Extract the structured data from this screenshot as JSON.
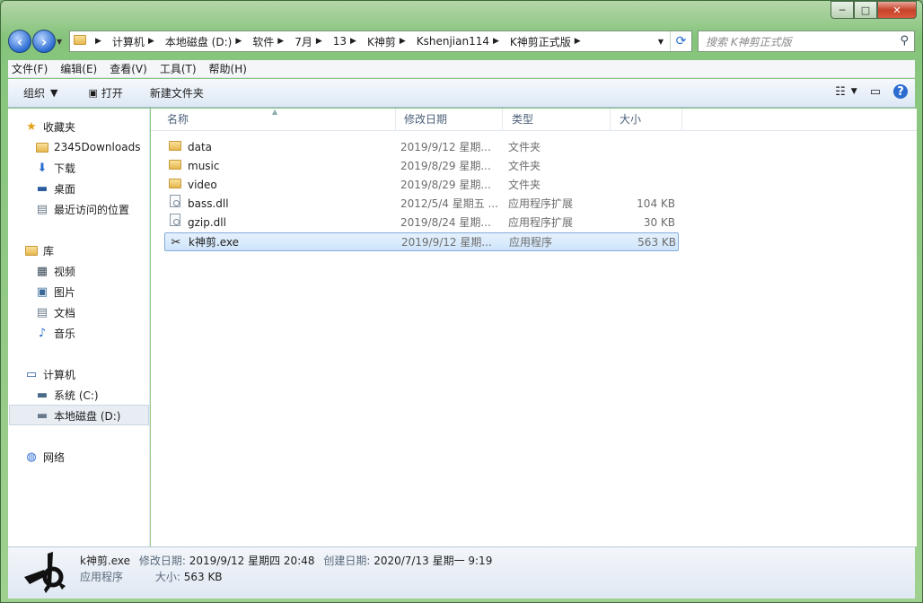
{
  "window": {
    "caption": {
      "minimize": "─",
      "maximize": "□",
      "close": "✕"
    }
  },
  "address": {
    "crumbs": [
      "计算机",
      "本地磁盘 (D:)",
      "软件",
      "7月",
      "13",
      "K神剪",
      "Kshenjian114",
      "K神剪正式版"
    ],
    "search_placeholder": "搜索 K神剪正式版"
  },
  "menu": [
    "文件(F)",
    "编辑(E)",
    "查看(V)",
    "工具(T)",
    "帮助(H)"
  ],
  "toolbar": {
    "organize": "组织",
    "open": "打开",
    "new_folder": "新建文件夹"
  },
  "nav": {
    "favorites": "收藏夹",
    "fav_items": [
      "2345Downloads",
      "下载",
      "桌面",
      "最近访问的位置"
    ],
    "library": "库",
    "lib_items": [
      "视频",
      "图片",
      "文档",
      "音乐"
    ],
    "computer": "计算机",
    "drives": [
      "系统 (C:)",
      "本地磁盘 (D:)"
    ],
    "network": "网络"
  },
  "columns": {
    "name": "名称",
    "date": "修改日期",
    "type": "类型",
    "size": "大小"
  },
  "files": [
    {
      "name": "data",
      "date": "2019/9/12 星期...",
      "type": "文件夹",
      "size": "",
      "icon": "folder"
    },
    {
      "name": "music",
      "date": "2019/8/29 星期...",
      "type": "文件夹",
      "size": "",
      "icon": "folder"
    },
    {
      "name": "video",
      "date": "2019/8/29 星期...",
      "type": "文件夹",
      "size": "",
      "icon": "folder"
    },
    {
      "name": "bass.dll",
      "date": "2012/5/4 星期五 ...",
      "type": "应用程序扩展",
      "size": "104 KB",
      "icon": "dll"
    },
    {
      "name": "gzip.dll",
      "date": "2019/8/24 星期...",
      "type": "应用程序扩展",
      "size": "30 KB",
      "icon": "dll"
    },
    {
      "name": "k神剪.exe",
      "date": "2019/9/12 星期...",
      "type": "应用程序",
      "size": "563 KB",
      "icon": "scissors-app"
    }
  ],
  "details": {
    "name": "k神剪.exe",
    "modified_label": "修改日期:",
    "modified": "2019/9/12 星期四 20:48",
    "created_label": "创建日期:",
    "created": "2020/7/13 星期一 9:19",
    "type": "应用程序",
    "size_label": "大小:",
    "size": "563 KB"
  }
}
